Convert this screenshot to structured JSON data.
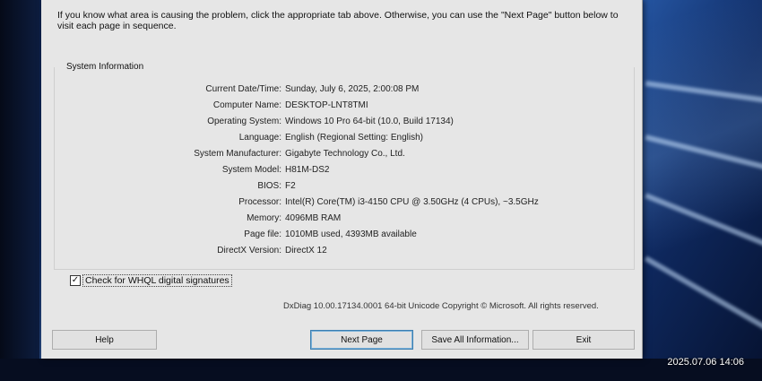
{
  "window": {
    "intro_text": "If you know what area is causing the problem, click the appropriate tab above.  Otherwise, you can use the \"Next Page\" button below to visit each page in sequence.",
    "group_title": "System Information"
  },
  "system_info": [
    {
      "label": "Current Date/Time:",
      "value": "Sunday, July 6, 2025, 2:00:08 PM"
    },
    {
      "label": "Computer Name:",
      "value": "DESKTOP-LNT8TMI"
    },
    {
      "label": "Operating System:",
      "value": "Windows 10 Pro 64-bit (10.0, Build 17134)"
    },
    {
      "label": "Language:",
      "value": "English (Regional Setting: English)"
    },
    {
      "label": "System Manufacturer:",
      "value": "Gigabyte Technology Co., Ltd."
    },
    {
      "label": "System Model:",
      "value": "H81M-DS2"
    },
    {
      "label": "BIOS:",
      "value": "F2"
    },
    {
      "label": "Processor:",
      "value": "Intel(R) Core(TM) i3-4150 CPU @ 3.50GHz (4 CPUs), ~3.5GHz"
    },
    {
      "label": "Memory:",
      "value": "4096MB RAM"
    },
    {
      "label": "Page file:",
      "value": "1010MB used, 4393MB available"
    },
    {
      "label": "DirectX Version:",
      "value": "DirectX 12"
    }
  ],
  "whql": {
    "checked": true,
    "check_mark": "✓",
    "label": "Check for WHQL digital signatures"
  },
  "version_text": "DxDiag 10.00.17134.0001 64-bit Unicode  Copyright © Microsoft. All rights reserved.",
  "buttons": {
    "help": "Help",
    "next_page": "Next Page",
    "save_all": "Save All Information...",
    "exit": "Exit"
  },
  "photo_timestamp": "2025.07.06 14:06"
}
